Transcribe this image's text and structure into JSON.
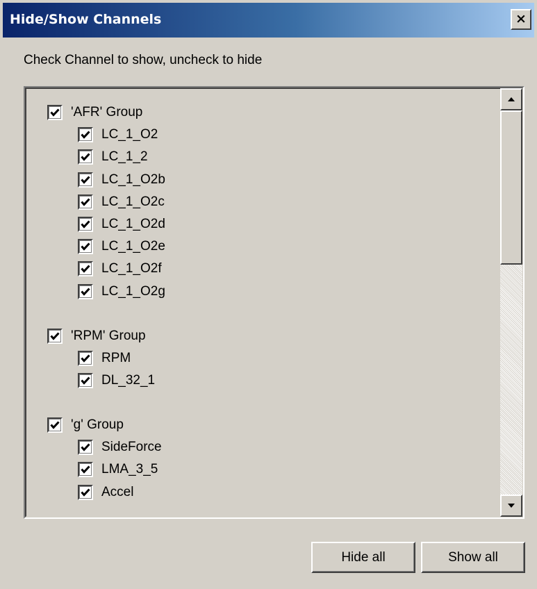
{
  "window": {
    "title": "Hide/Show Channels",
    "close_label": "×"
  },
  "instruction": "Check Channel to show, uncheck to hide",
  "groups": [
    {
      "label": "'AFR' Group",
      "checked": true,
      "channels": [
        {
          "label": "LC_1_O2",
          "checked": true
        },
        {
          "label": "LC_1_2",
          "checked": true
        },
        {
          "label": "LC_1_O2b",
          "checked": true
        },
        {
          "label": "LC_1_O2c",
          "checked": true
        },
        {
          "label": "LC_1_O2d",
          "checked": true
        },
        {
          "label": "LC_1_O2e",
          "checked": true
        },
        {
          "label": "LC_1_O2f",
          "checked": true
        },
        {
          "label": "LC_1_O2g",
          "checked": true
        }
      ]
    },
    {
      "label": "'RPM' Group",
      "checked": true,
      "channels": [
        {
          "label": "RPM",
          "checked": true
        },
        {
          "label": "DL_32_1",
          "checked": true
        }
      ]
    },
    {
      "label": "'g' Group",
      "checked": true,
      "channels": [
        {
          "label": "SideForce",
          "checked": true
        },
        {
          "label": "LMA_3_5",
          "checked": true
        },
        {
          "label": "Accel",
          "checked": true
        }
      ]
    }
  ],
  "buttons": {
    "hide_all": "Hide all",
    "show_all": "Show all"
  }
}
